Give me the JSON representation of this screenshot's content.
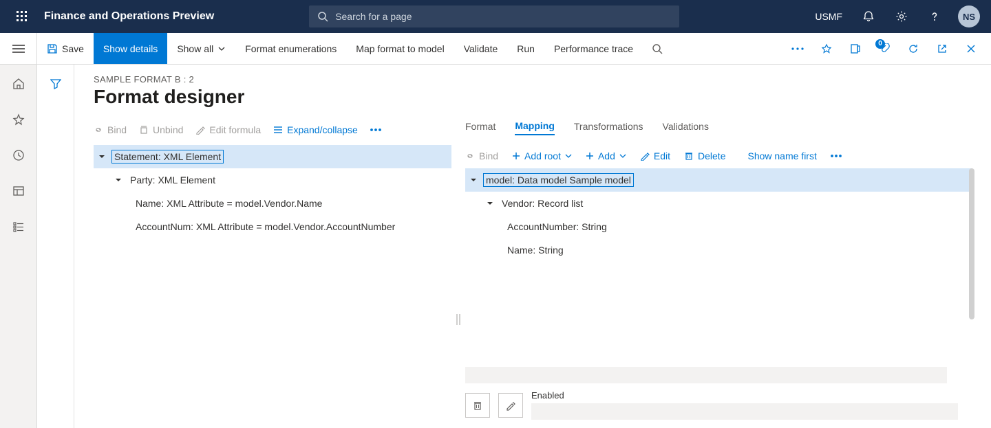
{
  "header": {
    "app_title": "Finance and Operations Preview",
    "search_placeholder": "Search for a page",
    "company": "USMF",
    "avatar_initials": "NS"
  },
  "cmdbar": {
    "save": "Save",
    "show_details": "Show details",
    "show_all": "Show all",
    "format_enums": "Format enumerations",
    "map_format": "Map format to model",
    "validate": "Validate",
    "run": "Run",
    "perf_trace": "Performance trace",
    "badge_count": "0"
  },
  "page": {
    "breadcrumb": "SAMPLE FORMAT B : 2",
    "title": "Format designer"
  },
  "left_toolbar": {
    "bind": "Bind",
    "unbind": "Unbind",
    "edit_formula": "Edit formula",
    "expand_collapse": "Expand/collapse"
  },
  "left_tree": {
    "n0": "Statement: XML Element",
    "n1": "Party: XML Element",
    "n2": "Name: XML Attribute = model.Vendor.Name",
    "n3": "AccountNum: XML Attribute = model.Vendor.AccountNumber"
  },
  "tabs": {
    "format": "Format",
    "mapping": "Mapping",
    "transformations": "Transformations",
    "validations": "Validations"
  },
  "right_toolbar": {
    "bind": "Bind",
    "add_root": "Add root",
    "add": "Add",
    "edit": "Edit",
    "delete": "Delete",
    "show_name_first": "Show name first"
  },
  "right_tree": {
    "n0": "model: Data model Sample model",
    "n1": "Vendor: Record list",
    "n2": "AccountNumber: String",
    "n3": "Name: String"
  },
  "bottom": {
    "prop_label": "Enabled"
  }
}
